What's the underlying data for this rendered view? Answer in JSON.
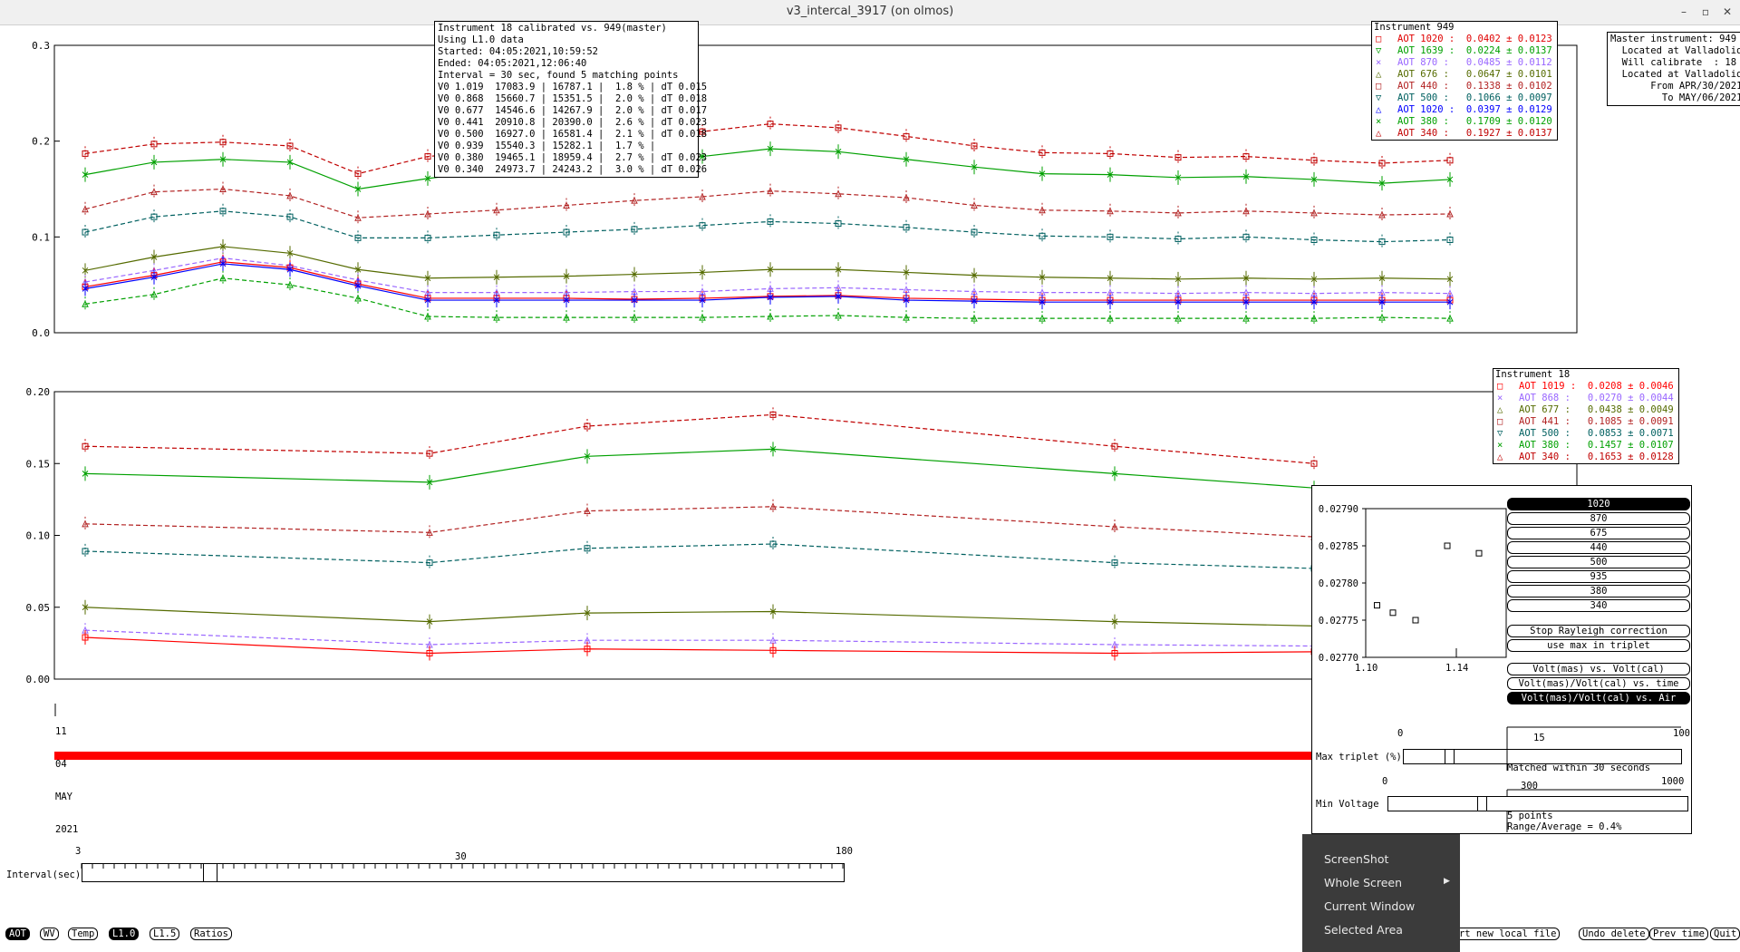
{
  "window": {
    "title": "v3_intercal_3917 (on olmos)",
    "minimize": "–",
    "maximize": "▫",
    "close": "✕"
  },
  "summary_box": {
    "lines": [
      "Instrument 18 calibrated vs. 949(master)",
      "Using L1.0 data",
      "Started: 04:05:2021,10:59:52",
      "Ended: 04:05:2021,12:06:40",
      "Interval = 30 sec, found 5 matching points",
      "V0 1.019  17083.9 | 16787.1 |  1.8 % | dT 0.015",
      "V0 0.868  15660.7 | 15351.5 |  2.0 % | dT 0.018",
      "V0 0.677  14546.6 | 14267.9 |  2.0 % | dT 0.017",
      "V0 0.441  20910.8 | 20390.0 |  2.6 % | dT 0.023",
      "V0 0.500  16927.0 | 16581.4 |  2.1 % | dT 0.018",
      "V0 0.939  15540.3 | 15282.1 |  1.7 % |",
      "V0 0.380  19465.1 | 18959.4 |  2.7 % | dT 0.023",
      "V0 0.340  24973.7 | 24243.2 |  3.0 % | dT 0.026"
    ]
  },
  "master_box": {
    "lines": [
      "Master instrument: 949",
      "  Located at Valladolid",
      "  Will calibrate  : 18",
      "  Located at Valladolid",
      "       From APR/30/2021",
      "         To MAY/06/2021"
    ]
  },
  "legend_949": {
    "header": "Instrument 949",
    "entries": [
      {
        "sym": "□",
        "label": "AOT 1020 :  ",
        "value": "0.0402 ± 0.0123",
        "color": "#e00000"
      },
      {
        "sym": "▽",
        "label": "AOT 1639 :  ",
        "value": "0.0224 ± 0.0137",
        "color": "#00a000"
      },
      {
        "sym": "×",
        "label": "AOT 870 :   ",
        "value": "0.0485 ± 0.0112",
        "color": "#9966ff"
      },
      {
        "sym": "△",
        "label": "AOT 676 :   ",
        "value": "0.0647 ± 0.0101",
        "color": "#556b00"
      },
      {
        "sym": "□",
        "label": "AOT 440 :   ",
        "value": "0.1338 ± 0.0102",
        "color": "#b22222"
      },
      {
        "sym": "▽",
        "label": "AOT 500 :   ",
        "value": "0.1066 ± 0.0097",
        "color": "#006060"
      },
      {
        "sym": "△",
        "label": "AOT 1020 :  ",
        "value": "0.0397 ± 0.0129",
        "color": "#0000ff"
      },
      {
        "sym": "×",
        "label": "AOT 380 :   ",
        "value": "0.1709 ± 0.0120",
        "color": "#00a000"
      },
      {
        "sym": "△",
        "label": "AOT 340 :   ",
        "value": "0.1927 ± 0.0137",
        "color": "#c00000"
      }
    ]
  },
  "legend_18": {
    "header": "Instrument 18",
    "entries": [
      {
        "sym": "□",
        "label": "AOT 1019 :  ",
        "value": "0.0208 ± 0.0046",
        "color": "#ff0000"
      },
      {
        "sym": "×",
        "label": "AOT 868 :   ",
        "value": "0.0270 ± 0.0044",
        "color": "#9966ff"
      },
      {
        "sym": "△",
        "label": "AOT 677 :   ",
        "value": "0.0438 ± 0.0049",
        "color": "#556b00"
      },
      {
        "sym": "□",
        "label": "AOT 441 :   ",
        "value": "0.1085 ± 0.0091",
        "color": "#b22222"
      },
      {
        "sym": "▽",
        "label": "AOT 500 :   ",
        "value": "0.0853 ± 0.0071",
        "color": "#006060"
      },
      {
        "sym": "×",
        "label": "AOT 380 :   ",
        "value": "0.1457 ± 0.0107",
        "color": "#00a000"
      },
      {
        "sym": "△",
        "label": "AOT 340 :   ",
        "value": "0.1653 ± 0.0128",
        "color": "#c00000"
      }
    ]
  },
  "top_plot": {
    "yticks": [
      "0.3",
      "0.2",
      "0.1",
      "0.0"
    ],
    "series": [
      {
        "color": "#c00000",
        "dash": true,
        "y": [
          0.187,
          0.197,
          0.199,
          0.195,
          0.166,
          0.184,
          0.19,
          0.195,
          0.2,
          0.21,
          0.218,
          0.214,
          0.205,
          0.195,
          0.188,
          0.187,
          0.183,
          0.184,
          0.18,
          0.177,
          0.18
        ]
      },
      {
        "color": "#00a000",
        "dash": false,
        "y": [
          0.165,
          0.178,
          0.181,
          0.178,
          0.15,
          0.161,
          0.17,
          0.175,
          0.178,
          0.184,
          0.192,
          0.189,
          0.181,
          0.173,
          0.166,
          0.165,
          0.162,
          0.163,
          0.16,
          0.156,
          0.16
        ]
      },
      {
        "color": "#b22222",
        "dash": true,
        "y": [
          0.129,
          0.147,
          0.15,
          0.143,
          0.12,
          0.124,
          0.128,
          0.133,
          0.138,
          0.142,
          0.148,
          0.145,
          0.141,
          0.133,
          0.128,
          0.127,
          0.125,
          0.127,
          0.125,
          0.123,
          0.124
        ]
      },
      {
        "color": "#006060",
        "dash": true,
        "y": [
          0.105,
          0.121,
          0.127,
          0.121,
          0.099,
          0.099,
          0.102,
          0.105,
          0.108,
          0.112,
          0.116,
          0.114,
          0.11,
          0.105,
          0.101,
          0.1,
          0.098,
          0.1,
          0.097,
          0.095,
          0.097
        ]
      },
      {
        "color": "#556b00",
        "dash": false,
        "y": [
          0.065,
          0.079,
          0.09,
          0.083,
          0.066,
          0.057,
          0.058,
          0.059,
          0.061,
          0.063,
          0.066,
          0.066,
          0.063,
          0.06,
          0.058,
          0.057,
          0.056,
          0.057,
          0.056,
          0.057,
          0.056
        ]
      },
      {
        "color": "#9966ff",
        "dash": true,
        "y": [
          0.053,
          0.065,
          0.078,
          0.07,
          0.055,
          0.042,
          0.042,
          0.042,
          0.043,
          0.043,
          0.046,
          0.047,
          0.045,
          0.043,
          0.042,
          0.042,
          0.041,
          0.042,
          0.041,
          0.042,
          0.041
        ]
      },
      {
        "color": "#ff0000",
        "dash": false,
        "y": [
          0.048,
          0.06,
          0.074,
          0.068,
          0.051,
          0.036,
          0.036,
          0.036,
          0.035,
          0.036,
          0.038,
          0.039,
          0.036,
          0.035,
          0.034,
          0.034,
          0.034,
          0.034,
          0.034,
          0.034,
          0.034
        ]
      },
      {
        "color": "#0000ff",
        "dash": false,
        "y": [
          0.046,
          0.058,
          0.072,
          0.066,
          0.049,
          0.034,
          0.034,
          0.034,
          0.034,
          0.034,
          0.037,
          0.038,
          0.034,
          0.033,
          0.032,
          0.032,
          0.032,
          0.032,
          0.032,
          0.032,
          0.032
        ]
      },
      {
        "color": "#00a000",
        "dash": true,
        "y": [
          0.03,
          0.04,
          0.057,
          0.05,
          0.036,
          0.017,
          0.016,
          0.016,
          0.016,
          0.016,
          0.017,
          0.018,
          0.016,
          0.015,
          0.015,
          0.015,
          0.015,
          0.015,
          0.015,
          0.016,
          0.015
        ]
      }
    ]
  },
  "bottom_plot": {
    "yticks": [
      "0.20",
      "0.15",
      "0.10",
      "0.05",
      "0.00"
    ],
    "date_label": [
      "11",
      "04",
      "MAY",
      "2021"
    ],
    "series": [
      {
        "color": "#c00000",
        "dash": true,
        "y": [
          0.162,
          0.157,
          0.176,
          0.184,
          0.162,
          0.15
        ]
      },
      {
        "color": "#00a000",
        "dash": false,
        "y": [
          0.143,
          0.137,
          0.155,
          0.16,
          0.143,
          0.133
        ]
      },
      {
        "color": "#b22222",
        "dash": true,
        "y": [
          0.108,
          0.102,
          0.117,
          0.12,
          0.106,
          0.099
        ]
      },
      {
        "color": "#006060",
        "dash": true,
        "y": [
          0.089,
          0.081,
          0.091,
          0.094,
          0.081,
          0.077
        ]
      },
      {
        "color": "#556b00",
        "dash": false,
        "y": [
          0.05,
          0.04,
          0.046,
          0.047,
          0.04,
          0.037
        ]
      },
      {
        "color": "#9966ff",
        "dash": true,
        "y": [
          0.034,
          0.024,
          0.027,
          0.027,
          0.024,
          0.023
        ]
      },
      {
        "color": "#ff0000",
        "dash": false,
        "y": [
          0.029,
          0.018,
          0.021,
          0.02,
          0.018,
          0.019
        ]
      }
    ]
  },
  "cal_panel": {
    "scatter": {
      "yticks": [
        "0.02790",
        "0.02785",
        "0.02780",
        "0.02775",
        "0.02770"
      ],
      "xticks": [
        "1.10",
        "1.14"
      ],
      "points": [
        [
          1.105,
          0.02777
        ],
        [
          1.112,
          0.02776
        ],
        [
          1.122,
          0.02775
        ],
        [
          1.136,
          0.02785
        ],
        [
          1.15,
          0.02784
        ]
      ]
    },
    "wavelengths": [
      "1020",
      "870",
      "675",
      "440",
      "500",
      "935",
      "380",
      "340"
    ],
    "selected_wavelength": "1020",
    "rayleigh_button": "Stop Rayleigh correction",
    "max_triplet_button": "use max in triplet",
    "plot_modes": [
      "Volt(mas) vs. Volt(cal)",
      "Volt(mas)/Volt(cal) vs. time",
      "Volt(mas)/Volt(cal) vs. Air Mass"
    ],
    "selected_plot_mode": "Volt(mas)/Volt(cal) vs. Air Mass",
    "max_triplet": {
      "label": "Max triplet (%)",
      "min": "0",
      "value": "15",
      "max": "100",
      "note": "Matched within 30 seconds",
      "fraction": 0.15
    },
    "min_voltage": {
      "label": "Min Voltage",
      "min": "0",
      "value": "300",
      "max": "1000",
      "note1": "5 points",
      "note2": "Range/Average = 0.4%",
      "fraction": 0.3
    }
  },
  "interval_slider": {
    "label": "Interval(sec)",
    "min": "3",
    "mid": "30",
    "max": "180",
    "fraction": 0.16
  },
  "bottom_toolbar": {
    "data_buttons": [
      "AOT",
      "WV",
      "Temp",
      "L1.0",
      "L1.5",
      "Ratios"
    ],
    "selected_data": [
      "AOT",
      "L1.0"
    ],
    "actions": [
      "Start new local file",
      "Undo delete",
      "Prev time",
      "Quit"
    ]
  },
  "context_menu": {
    "items": [
      "ScreenShot",
      "Whole Screen",
      "Current Window",
      "Selected Area"
    ],
    "submenu_arrow": "▶"
  }
}
